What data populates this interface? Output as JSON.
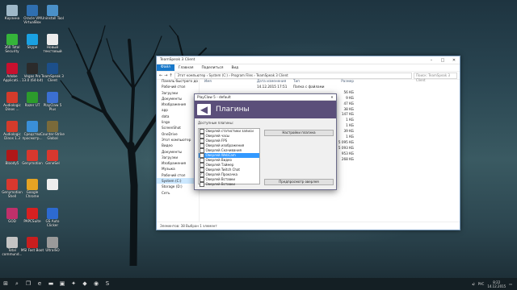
{
  "desktop_icons": [
    {
      "label": "Корзина",
      "color": "#9fb8c8"
    },
    {
      "label": "Oracle VM VirtualBox",
      "color": "#2f6fb0"
    },
    {
      "label": "Uninstall Tool",
      "color": "#4a90c8"
    },
    {
      "label": "360 Total Security",
      "color": "#35b43a"
    },
    {
      "label": "Skype",
      "color": "#1aa1e2"
    },
    {
      "label": "Новый текстовый",
      "color": "#ececec"
    },
    {
      "label": "Adobe Applicati...",
      "color": "#c8102e"
    },
    {
      "label": "Vegas Pro 13.0 (64-bit)",
      "color": "#2b2b2b"
    },
    {
      "label": "TeamSpeak 3 Client",
      "color": "#1c4f8a"
    },
    {
      "label": "Audiologic Dinos ...",
      "color": "#d43b2b"
    },
    {
      "label": "Razer UT",
      "color": "#2c9b2c"
    },
    {
      "label": "PlayClaw 5 Plus",
      "color": "#3b6fd1"
    },
    {
      "label": "Audiologic Dinos 1.3",
      "color": "#d43b2b"
    },
    {
      "label": "Средство просмотр...",
      "color": "#3a8fd8"
    },
    {
      "label": "Counter-Strike Global",
      "color": "#7a6a3a"
    },
    {
      "label": "Bloody5",
      "color": "#b01818"
    },
    {
      "label": "Genymotion",
      "color": "#d8382e"
    },
    {
      "label": "GeneSel",
      "color": "#d8382e"
    },
    {
      "label": "Genymotion Shell",
      "color": "#d8382e"
    },
    {
      "label": "Google Chrome",
      "color": "#e5a323"
    },
    {
      "label": "",
      "color": "#eeeeee"
    },
    {
      "label": "GOD",
      "color": "#c0306a"
    },
    {
      "label": "PAPCSuite",
      "color": "#d82020"
    },
    {
      "label": "GS Auto Clicker",
      "color": "#2d6ad0"
    },
    {
      "label": "Total commund...",
      "color": "#c4c4c4"
    },
    {
      "label": "MSI Fast Boot",
      "color": "#c81e1e"
    },
    {
      "label": "UltraISO",
      "color": "#9a9a9a"
    }
  ],
  "explorer": {
    "title": "TeamSpeak 3 Client",
    "ribbon_tabs": [
      "Файл",
      "Главная",
      "Поделиться",
      "Вид"
    ],
    "address": "Этот компьютер › System (C:) › Program Files › TeamSpeak 3 Client",
    "search_placeholder": "Поиск: TeamSpeak 3 Client",
    "nav": [
      "Панель быстрого до",
      "Рабочий стол",
      "Загрузки",
      "Документы",
      "Изображения",
      "app",
      "data",
      "lingo",
      "ScreenShot",
      "OneDrive",
      "Этот компьютер",
      "Видео",
      "Документы",
      "Загрузки",
      "Изображения",
      "Музыка",
      "Рабочий стол",
      "System (C:)",
      "Storage (D:)",
      "Сеть"
    ],
    "nav_selected": "System (C:)",
    "columns": [
      "Имя",
      "Дата изменения",
      "Тип",
      "Размер"
    ],
    "files": [
      {
        "name": "",
        "date": "14.12.2015 17:51",
        "type": "Папка с файлами",
        "size": ""
      },
      {
        "name": "",
        "date": "",
        "type": "",
        "size": "56 КБ"
      },
      {
        "name": "",
        "date": "",
        "type": "",
        "size": "9 КБ"
      },
      {
        "name": "",
        "date": "",
        "type": "",
        "size": "47 КБ"
      },
      {
        "name": "",
        "date": "",
        "type": "",
        "size": "38 КБ"
      },
      {
        "name": "",
        "date": "",
        "type": "",
        "size": "147 КБ"
      },
      {
        "name": "",
        "date": "",
        "type": "",
        "size": "1 КБ"
      },
      {
        "name": "",
        "date": "",
        "type": "",
        "size": "1 КБ"
      },
      {
        "name": "package_inst",
        "date": "21.09.2015 16:44",
        "type": "Приложение",
        "size": "39 КБ"
      },
      {
        "name": "plugin_sdk",
        "date": "22.09.2015 17:15",
        "type": "Build \"HTML\"",
        "size": "1 КБ"
      },
      {
        "name": "Qt5Core.dll",
        "date": "21.09.2015 17:46",
        "type": "Расширение при...",
        "size": "5 095 КБ"
      },
      {
        "name": "Qt5Gui.dll",
        "date": "21.09.2015 17:46",
        "type": "Расширение при...",
        "size": "5 093 КБ"
      },
      {
        "name": "Qt5Network.dll",
        "date": "21.09.2015 17:46",
        "type": "Расширение при...",
        "size": "953 КБ"
      },
      {
        "name": "Qt5Sql.dll",
        "date": "21.09.2015 17:47",
        "type": "Расширение при...",
        "size": "268 КБ"
      }
    ],
    "status": "Элементов: 38    Выбран 1 элемент"
  },
  "dialog": {
    "title": "PlayClaw 5 - default",
    "heading": "Плагины",
    "list_label": "Доступные плагины:",
    "plugins": [
      "Оверлей статистики записи",
      "Оверлей часы",
      "Оверлей FPS",
      "Оверлей изображения",
      "Оверлей Скачивания",
      "Оверлей WebCam",
      "Оверлей Видео",
      "Оверлей Таймер",
      "Оверлей Twitch Chat",
      "Оверлей Прокачка",
      "Оверлей Вставки",
      "Оверлей Вставки"
    ],
    "selected_index": 5,
    "checked": [
      9
    ],
    "settings_button": "Настройки плагина",
    "preview_button": "Предпросмотр оверлея"
  },
  "taskbar": {
    "apps": [
      "start-icon",
      "search-icon",
      "task-view-icon",
      "edge-icon",
      "explorer-icon",
      "store-icon",
      "razer-icon",
      "playclaw-icon",
      "chrome-icon",
      "skype-icon"
    ],
    "language": "РУС",
    "time": "8:22",
    "date": "14.12.2015"
  }
}
